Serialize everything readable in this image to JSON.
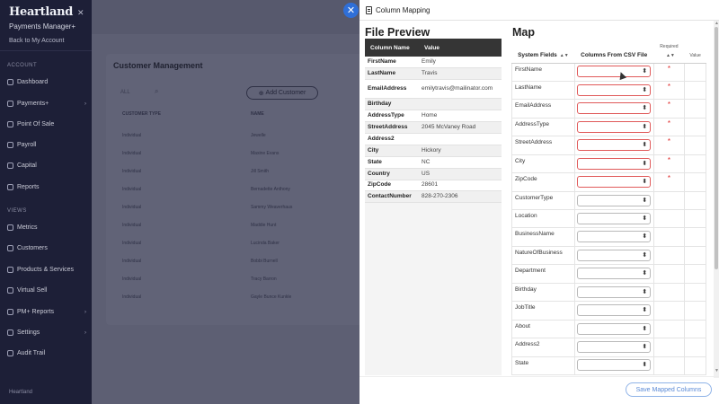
{
  "background_app": {
    "brand": "Heartland",
    "brand_sub": "Payments Manager+",
    "back_link": "Back to My Account",
    "sections": [
      "ACCOUNT",
      "VIEWS"
    ],
    "nav": [
      {
        "label": "Dashboard",
        "chevron": false
      },
      {
        "label": "Payments+",
        "chevron": true
      },
      {
        "label": "Point Of Sale",
        "chevron": false
      },
      {
        "label": "Payroll",
        "chevron": false
      },
      {
        "label": "Capital",
        "chevron": false
      },
      {
        "label": "Reports",
        "chevron": false
      },
      {
        "label": "Metrics",
        "chevron": false
      },
      {
        "label": "Customers",
        "chevron": false
      },
      {
        "label": "Products & Services",
        "chevron": false
      },
      {
        "label": "Virtual Sell",
        "chevron": false
      },
      {
        "label": "PM+ Reports",
        "chevron": true
      },
      {
        "label": "Settings",
        "chevron": true
      },
      {
        "label": "Audit Trail",
        "chevron": false
      }
    ],
    "footer": "Heartland",
    "page_title": "Customer Management",
    "search_label": "ALL",
    "add_customer": "Add Customer",
    "columns": [
      "CUSTOMER TYPE",
      "NAME"
    ],
    "rows": [
      [
        "Individual",
        "Jewelle"
      ],
      [
        "Individual",
        "Maxine Evans"
      ],
      [
        "Individual",
        "Jill Smith"
      ],
      [
        "Individual",
        "Bernadette Anthony"
      ],
      [
        "Individual",
        "Sammy Weaverhaus"
      ],
      [
        "Individual",
        "Maddie Hunt"
      ],
      [
        "Individual",
        "Lucinda Baker"
      ],
      [
        "Individual",
        "Bobbi Burnell"
      ],
      [
        "Individual",
        "Tracy Barron"
      ],
      [
        "Individual",
        "Gayle Bunce Kunkle"
      ]
    ]
  },
  "drawer": {
    "title": "Column Mapping",
    "file_preview": {
      "title": "File Preview",
      "headers": [
        "Column Name",
        "Value"
      ],
      "rows": [
        {
          "name": "FirstName",
          "value": "Emily"
        },
        {
          "name": "LastName",
          "value": "Travis"
        },
        {
          "name": "EmailAddress",
          "value": "emilytravis@mailinator.com"
        },
        {
          "name": "Birthday",
          "value": ""
        },
        {
          "name": "AddressType",
          "value": "Home"
        },
        {
          "name": "StreetAddress",
          "value": "2045 McVaney Road"
        },
        {
          "name": "Address2",
          "value": ""
        },
        {
          "name": "City",
          "value": "Hickory"
        },
        {
          "name": "State",
          "value": "NC"
        },
        {
          "name": "Country",
          "value": "US"
        },
        {
          "name": "ZipCode",
          "value": "28601"
        },
        {
          "name": "ContactNumber",
          "value": "828-270-2306"
        }
      ]
    },
    "map": {
      "title": "Map",
      "headers": {
        "system": "System Fields",
        "csv": "Columns From CSV File",
        "required": "Required",
        "value": "Value"
      },
      "rows": [
        {
          "field": "FirstName",
          "required": true
        },
        {
          "field": "LastName",
          "required": true
        },
        {
          "field": "EmailAddress",
          "required": true
        },
        {
          "field": "AddressType",
          "required": true
        },
        {
          "field": "StreetAddress",
          "required": true
        },
        {
          "field": "City",
          "required": true
        },
        {
          "field": "ZipCode",
          "required": true
        },
        {
          "field": "CustomerType",
          "required": false
        },
        {
          "field": "Location",
          "required": false
        },
        {
          "field": "BusinessName",
          "required": false
        },
        {
          "field": "NatureOfBusiness",
          "required": false
        },
        {
          "field": "Department",
          "required": false
        },
        {
          "field": "Birthday",
          "required": false
        },
        {
          "field": "JobTitle",
          "required": false
        },
        {
          "field": "About",
          "required": false
        },
        {
          "field": "Address2",
          "required": false
        },
        {
          "field": "State",
          "required": false
        }
      ],
      "required_mark": "*"
    },
    "save_button": "Save Mapped Columns"
  },
  "colors": {
    "accent": "#2f6fd8",
    "error": "#e02a2a",
    "sidebar": "#1d1f37",
    "table_header": "#353535"
  }
}
